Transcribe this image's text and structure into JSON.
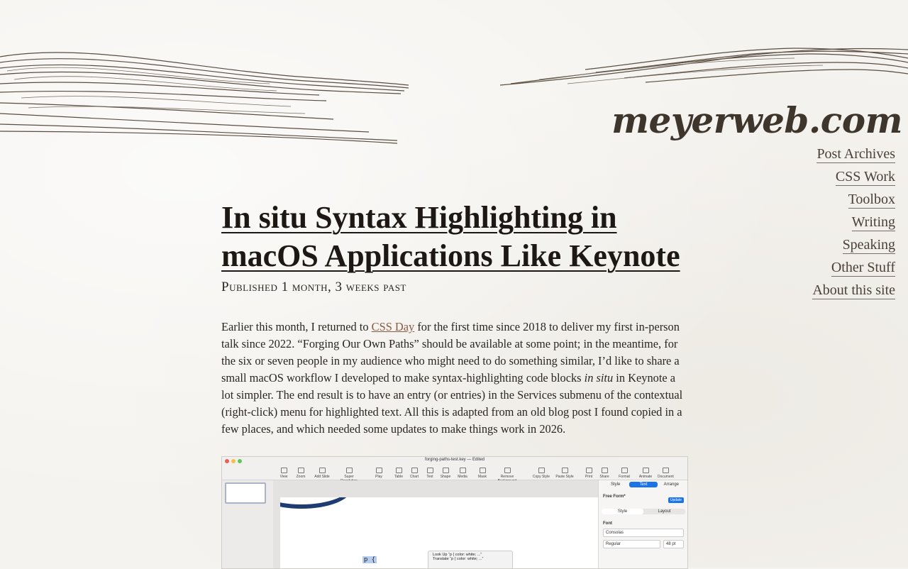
{
  "site": {
    "title": "meyerweb.com"
  },
  "nav": {
    "items": [
      {
        "label": "Post Archives"
      },
      {
        "label": "CSS Work"
      },
      {
        "label": "Toolbox"
      },
      {
        "label": "Writing"
      },
      {
        "label": "Speaking"
      },
      {
        "label": "Other Stuff"
      },
      {
        "label": "About this site"
      }
    ]
  },
  "post": {
    "title": "In situ Syntax Highlighting in macOS Applications Like Keynote",
    "published": "Published 1 month, 3 weeks past",
    "body": {
      "intro": "Earlier this month, I returned to ",
      "link": "CSS Day",
      "part2": " for the first time since 2018 to deliver my first in-person talk since 2022.  “Forging Our Own Paths” should be available at some point; in the meantime, for the six or seven people in my audience who might need to do something similar, I’d like to share a small macOS workflow I developed to make syntax-highlighting code blocks ",
      "emph": "in situ",
      "part3": " in Keynote a lot simpler.  The end result is to have an entry (or entries) in the Services submenu of the contextual (right-click) menu for highlighted text.  All this is adapted from an old blog post I found copied in a few places, and which needed some updates to make things work in 2026."
    }
  },
  "screenshot": {
    "doc_title": "forging-paths-test.key — Edited",
    "toolbar": [
      "View",
      "Zoom",
      "Add Slide",
      "Super Resolution",
      "Play",
      "Table",
      "Chart",
      "Text",
      "Shape",
      "Media",
      "Mask",
      "Remove Background",
      "Copy Style",
      "Paste Style",
      "Print",
      "Share",
      "Format",
      "Animate",
      "Document"
    ],
    "inspector_tabs": [
      "Style",
      "Text",
      "Arrange"
    ],
    "paragraph_style": "Free Form*",
    "update_label": "Update",
    "sub_tabs": [
      "Style",
      "Layout"
    ],
    "font_label": "Font",
    "font_name": "Consolas",
    "font_weight": "Regular",
    "font_size": "48 pt",
    "code_text": "p {",
    "context_menu": [
      "Look Up “p {    color: white;    ...”",
      "Translate “p {    color: white;    ...”"
    ]
  }
}
